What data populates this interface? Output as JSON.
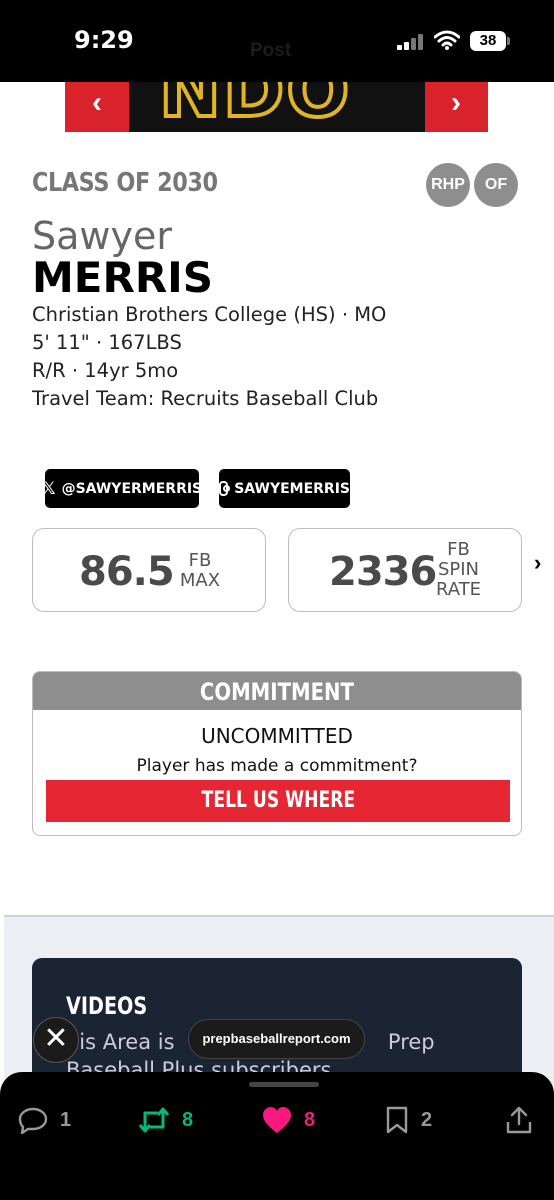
{
  "status_bar": {
    "time": "9:29",
    "battery": "38",
    "behind_title": "Post"
  },
  "hero": {
    "jersey_text": "NDO",
    "prev_glyph": "‹",
    "next_glyph": "›"
  },
  "profile": {
    "class_of": "CLASS OF 2030",
    "positions": [
      "RHP",
      "OF"
    ],
    "first_name": "Sawyer",
    "last_name": "MERRIS",
    "school": "Christian Brothers College (HS) · MO",
    "size": "5' 11\" · 167LBS",
    "bats_throws_age": "R/R · 14yr 5mo",
    "travel_team": "Travel Team: Recruits Baseball Club"
  },
  "socials": {
    "x_handle": "@SAWYERMERRIS",
    "instagram_handle": "SAWYEMERRIS"
  },
  "stats": [
    {
      "value": "86.5",
      "label_lines": [
        "FB",
        "MAX"
      ]
    },
    {
      "value": "2336",
      "label_lines": [
        "FB",
        "SPIN",
        "RATE"
      ]
    }
  ],
  "stats_next_glyph": "›",
  "commitment": {
    "header": "COMMITMENT",
    "status": "UNCOMMITTED",
    "question": "Player has made a commitment?",
    "button": "TELL US WHERE"
  },
  "videos": {
    "title": "VIDEOS",
    "line1": "his Area is",
    "line1_tail": "Prep",
    "line2": "Baseball Plus subscribers"
  },
  "overlay": {
    "close_glyph": "✕",
    "url": "prepbaseballreport.com"
  },
  "actions": {
    "replies": "1",
    "reposts": "8",
    "likes": "8",
    "bookmarks": "2"
  },
  "colors": {
    "accent_red": "#e62733",
    "repost_green": "#00ba7c",
    "like_pink": "#f91880",
    "header_gray": "#8e8e8e"
  },
  "icons": [
    "signal-icon",
    "wifi-icon",
    "battery-icon",
    "x-logo-icon",
    "instagram-icon",
    "reply-icon",
    "repost-icon",
    "like-icon",
    "bookmark-icon",
    "share-icon"
  ]
}
